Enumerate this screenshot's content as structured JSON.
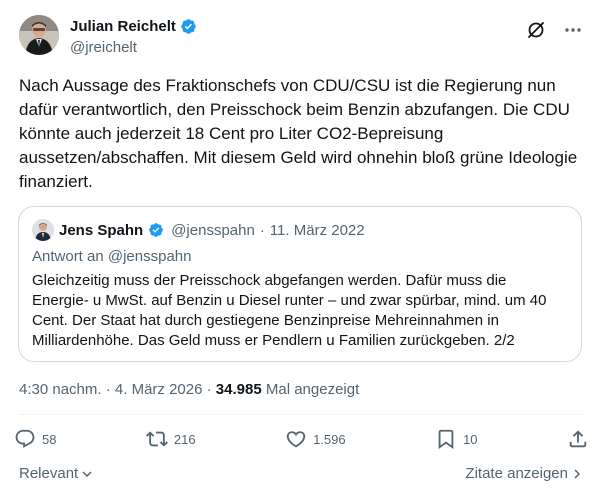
{
  "author": {
    "display_name": "Julian Reichelt",
    "handle": "@jreichelt"
  },
  "tweet": {
    "text": "Nach Aussage des Fraktionschefs von CDU/CSU ist die Regierung nun dafür verantwortlich, den Preisschock beim Benzin abzufangen. Die CDU könnte auch jederzeit 18 Cent pro Liter CO2-Bepreisung aussetzen/abschaffen. Mit diesem Geld wird ohnehin bloß grüne Ideologie finanziert."
  },
  "quote": {
    "display_name": "Jens Spahn",
    "handle": "@jensspahn",
    "separator": "·",
    "date": "11. März 2022",
    "reply_to": "Antwort an @jensspahn",
    "text": "Gleichzeitig muss der Preisschock abgefangen werden. Dafür muss die Energie- u MwSt. auf Benzin u Diesel runter – und zwar spürbar, mind. um 40 Cent. Der Staat hat durch gestiegene Benzinpreise Mehreinnahmen in Milliardenhöhe. Das Geld muss er Pendlern u Familien zurückgeben. 2/2"
  },
  "meta": {
    "time": "4:30 nachm.",
    "sep1": "·",
    "date": "4. März 2026",
    "sep2": "·",
    "views": "34.985",
    "views_label": "Mal angezeigt"
  },
  "actions": {
    "replies": "58",
    "reposts": "216",
    "likes": "1.596",
    "bookmarks": "10"
  },
  "footer": {
    "sort_label": "Relevant",
    "quotes_label": "Zitate anzeigen"
  },
  "colors": {
    "verified": "#1d9bf0",
    "secondary_text": "#536471",
    "border": "#cfd9de"
  }
}
